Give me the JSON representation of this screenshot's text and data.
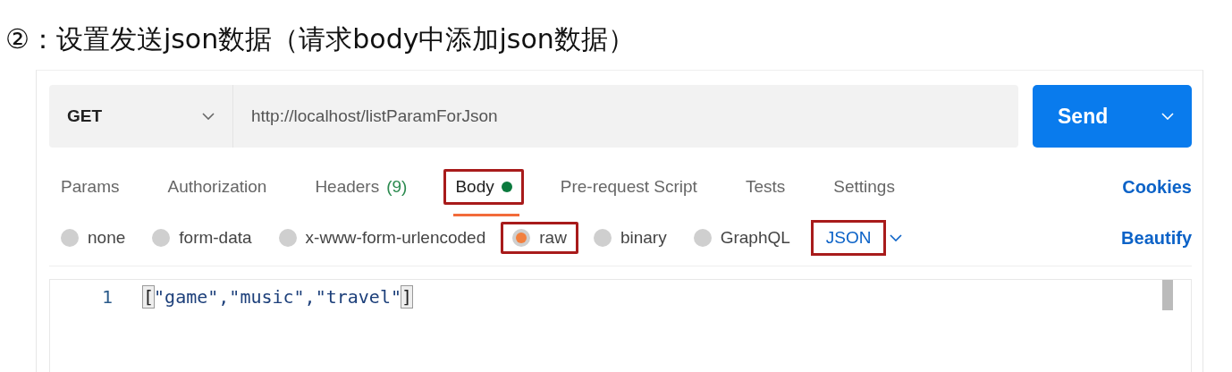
{
  "heading": "②：设置发送json数据（请求body中添加json数据）",
  "request": {
    "method": "GET",
    "url": "http://localhost/listParamForJson",
    "send": "Send"
  },
  "tabs": [
    {
      "label": "Params",
      "selected": false,
      "highlighted": false
    },
    {
      "label": "Authorization",
      "selected": false,
      "highlighted": false
    },
    {
      "label": "Headers",
      "count": "(9)",
      "selected": false,
      "highlighted": false
    },
    {
      "label": "Body",
      "selected": true,
      "dot": true,
      "highlighted": true
    },
    {
      "label": "Pre-request Script",
      "selected": false,
      "highlighted": false
    },
    {
      "label": "Tests",
      "selected": false,
      "highlighted": false
    },
    {
      "label": "Settings",
      "selected": false,
      "highlighted": false
    }
  ],
  "cookies": "Cookies",
  "body_types": [
    {
      "label": "none",
      "selected": false,
      "highlighted": false
    },
    {
      "label": "form-data",
      "selected": false,
      "highlighted": false
    },
    {
      "label": "x-www-form-urlencoded",
      "selected": false,
      "highlighted": false
    },
    {
      "label": "raw",
      "selected": true,
      "highlighted": true
    },
    {
      "label": "binary",
      "selected": false,
      "highlighted": false
    },
    {
      "label": "GraphQL",
      "selected": false,
      "highlighted": false
    }
  ],
  "format": {
    "label": "JSON",
    "highlighted": true
  },
  "beautify": "Beautify",
  "editor": {
    "lines": [
      {
        "number": "1",
        "code": "[\"game\",\"music\",\"travel\"]",
        "bracket_match": true
      }
    ]
  }
}
